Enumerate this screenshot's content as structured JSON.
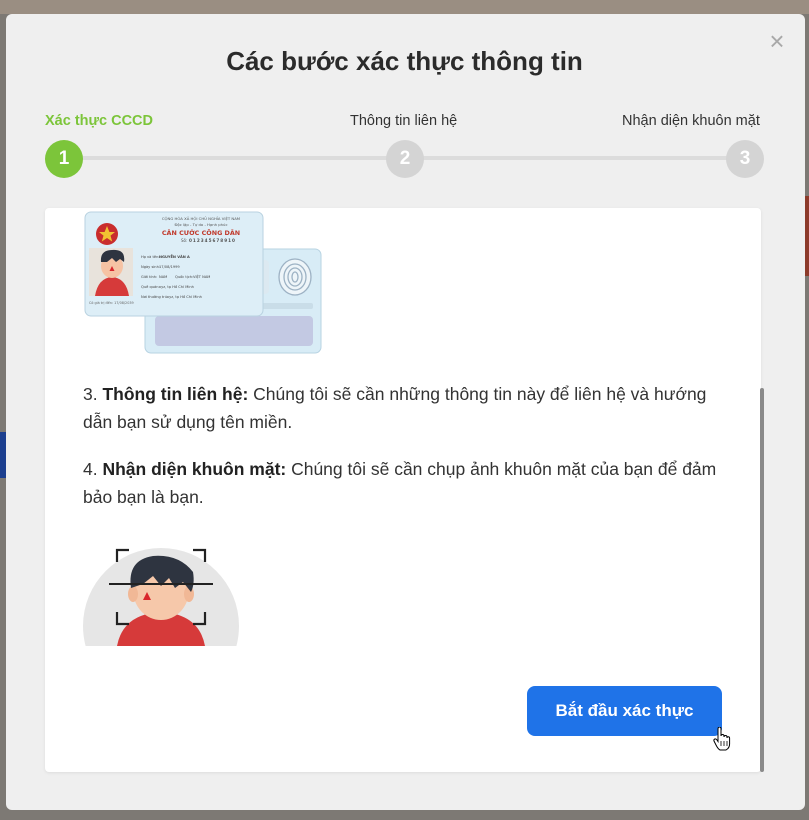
{
  "modal": {
    "title": "Các bước xác thực thông tin",
    "close_icon": "close-icon"
  },
  "steps": [
    {
      "label": "Xác thực CCCD",
      "number": "1",
      "active": true
    },
    {
      "label": "Thông tin liên hệ",
      "number": "2",
      "active": false
    },
    {
      "label": "Nhận diện khuôn mặt",
      "number": "3",
      "active": false
    }
  ],
  "content": {
    "id_card": {
      "country": "CỘNG HÒA XÃ HỘI CHỦ NGHĨA VIỆT NAM",
      "motto": "Độc lập - Tự do - Hạnh phúc",
      "card_title": "CĂN CƯỚC CÔNG DÂN",
      "number_label": "Số:",
      "number": "012345678910",
      "name_label": "Họ và tên:",
      "name": "NGUYỄN VĂN A",
      "dob_label": "Ngày sinh:",
      "dob": "17/08/1999",
      "sex_label": "Giới tính:",
      "sex": "NAM",
      "nationality_label": "Quốc tịch:",
      "nationality": "VIỆT NAM",
      "hometown_label": "Quê quán:",
      "hometown": "xyz, tp Hồ Chí Minh",
      "residence_label": "Nơi thường trú:",
      "residence": "xyz, tp Hồ Chí Minh",
      "expiry": "Có giá trị đến: 17/08/2039"
    },
    "step3": {
      "prefix": "3. ",
      "title": "Thông tin liên hệ:",
      "text": " Chúng tôi sẽ cần những thông tin này để liên hệ và hướng dẫn bạn sử dụng tên miền."
    },
    "step4": {
      "prefix": "4. ",
      "title": "Nhận diện khuôn mặt:",
      "text": " Chúng tôi sẽ cần chụp ảnh khuôn mặt của bạn để đảm bảo bạn là bạn."
    },
    "start_button": "Bắt đầu xác thực"
  },
  "colors": {
    "accent_green": "#7cc53a",
    "primary_blue": "#1f73e8",
    "inactive_gray": "#d4d4d4"
  }
}
